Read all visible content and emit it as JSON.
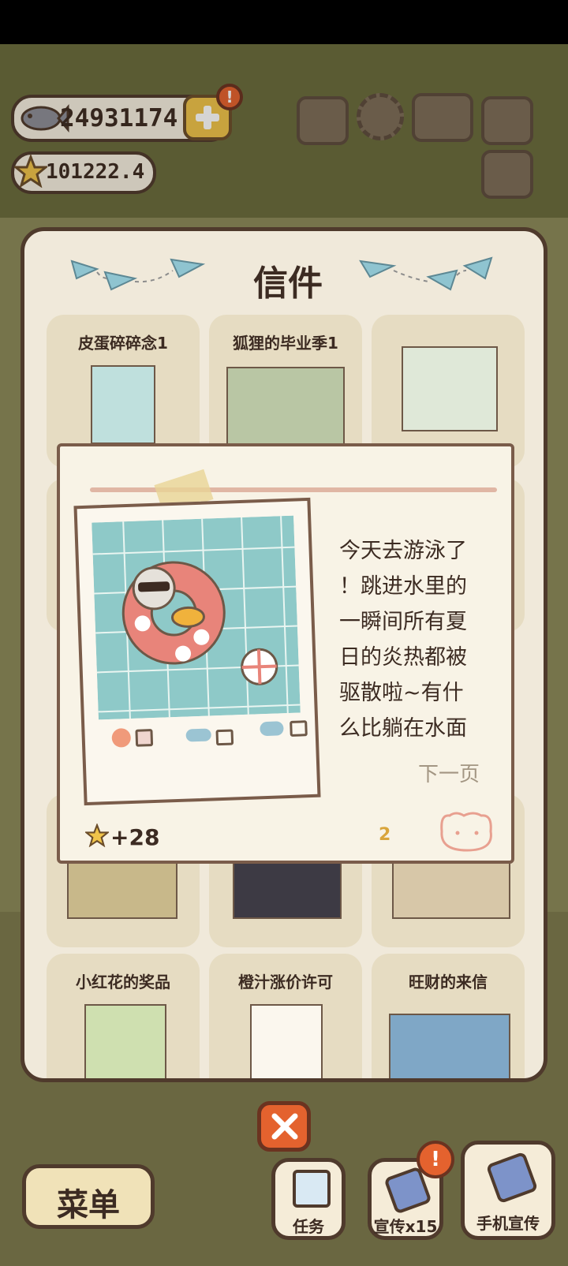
{
  "hud": {
    "fish_count": "24931174",
    "star_count": "101222.4",
    "add_badge": "!"
  },
  "dialog": {
    "title": "信件",
    "cards": [
      {
        "title": "皮蛋碎碎念1"
      },
      {
        "title": "狐狸的毕业季1"
      },
      {
        "title": ""
      },
      {
        "title": "小红花的奖品"
      },
      {
        "title": "橙汁涨价许可"
      },
      {
        "title": "旺财的来信"
      }
    ]
  },
  "letter": {
    "text_lines": [
      "今天去游泳了",
      "！跳进水里的",
      "一瞬间所有夏",
      "日的炎热都被",
      "驱散啦~有什",
      "么比躺在水面"
    ],
    "next_page": "下一页",
    "reward": "+28",
    "page_counter": "2"
  },
  "bottom": {
    "menu_label": "菜单",
    "tasks_label": "任务",
    "promo_label": "宣传x15",
    "phone_promo_label": "手机宣传",
    "promo_badge": "!"
  },
  "colors": {
    "accent": "#e4622e",
    "dark": "#4f3a2c",
    "panel": "#f0e9da",
    "pool": "#8ec9c8"
  }
}
